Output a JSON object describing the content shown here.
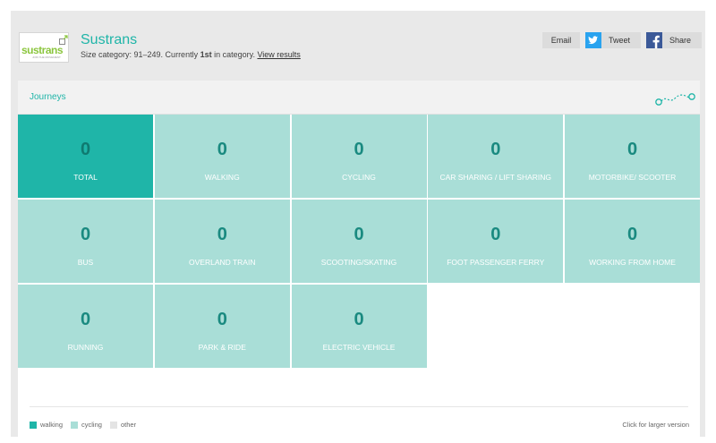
{
  "header": {
    "logo_text": "sustrans",
    "logo_tagline": "JOIN THE MOVEMENT",
    "org_name": "Sustrans",
    "size_prefix": "Size category: 91–249. Currently ",
    "rank": "1st",
    "size_suffix": " in category. ",
    "view_results": "View results"
  },
  "share": {
    "email": "Email",
    "tweet": "Tweet",
    "share": "Share"
  },
  "panel": {
    "title": "Journeys",
    "route_icon": "route-icon"
  },
  "tiles": [
    {
      "value": "0",
      "label": "TOTAL"
    },
    {
      "value": "0",
      "label": "WALKING"
    },
    {
      "value": "0",
      "label": "CYCLING"
    },
    {
      "value": "0",
      "label": "CAR SHARING / LIFT SHARING"
    },
    {
      "value": "0",
      "label": "MOTORBIKE/ SCOOTER"
    },
    {
      "value": "0",
      "label": "BUS"
    },
    {
      "value": "0",
      "label": "OVERLAND TRAIN"
    },
    {
      "value": "0",
      "label": "SCOOTING/SKATING"
    },
    {
      "value": "0",
      "label": "FOOT PASSENGER FERRY"
    },
    {
      "value": "0",
      "label": "WORKING FROM HOME"
    },
    {
      "value": "0",
      "label": "RUNNING"
    },
    {
      "value": "0",
      "label": "PARK & RIDE"
    },
    {
      "value": "0",
      "label": "ELECTRIC VEHICLE"
    }
  ],
  "legend": {
    "items": [
      {
        "label": "walking",
        "color": "#1fb5a8"
      },
      {
        "label": "cycling",
        "color": "#a9ded7"
      },
      {
        "label": "other",
        "color": "#e4e4e4"
      }
    ],
    "larger_version": "Click for larger version"
  },
  "colors": {
    "accent": "#1fb5a8",
    "tile": "#a9ded7",
    "twitter": "#2aa3ef",
    "facebook": "#3b5998"
  }
}
